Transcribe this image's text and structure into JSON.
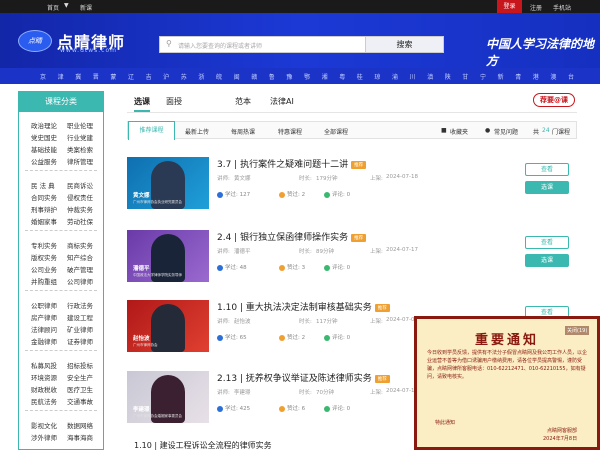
{
  "topbar": {
    "home": "首页",
    "caret": "▼",
    "news": "新课",
    "login": "登录",
    "register": "注册",
    "mobile": "手机站"
  },
  "header": {
    "logo_mark": "点睛",
    "logo_title": "点睛律师",
    "logo_url": "www.dtws.com",
    "search_placeholder": "请输入您要查询的课程或者讲师",
    "search_button": "搜索",
    "slogan": "中国人学习法律的地方"
  },
  "cities": [
    "京",
    "津",
    "冀",
    "晋",
    "蒙",
    "辽",
    "吉",
    "沪",
    "苏",
    "浙",
    "皖",
    "闽",
    "赣",
    "鲁",
    "豫",
    "鄂",
    "湘",
    "粤",
    "桂",
    "琼",
    "渝",
    "川",
    "滇",
    "陕",
    "甘",
    "宁",
    "新",
    "青",
    "港",
    "澳",
    "台"
  ],
  "sidebar": {
    "heading": "课程分类",
    "groups": [
      [
        "政治理论",
        "职业伦理",
        "党史国史",
        "行业党建",
        "基础技能",
        "类案检索",
        "公益服务",
        "律所管理"
      ],
      [
        "民 法 典",
        "民商诉讼",
        "合同实务",
        "侵权责任",
        "刑事辩护",
        "仲裁实务",
        "婚姻家事",
        "劳动社保"
      ],
      [
        "专利实务",
        "商标实务",
        "版权实务",
        "知产综合",
        "公司业务",
        "破产管理",
        "并购重组",
        "公司律师"
      ],
      [
        "公职律师",
        "行政法务",
        "房产律师",
        "建设工程",
        "法律顾问",
        "矿业律师",
        "金融律师",
        "证券律师"
      ],
      [
        "私募风投",
        "招标投标",
        "环境资源",
        "安全生产",
        "财政税收",
        "医疗卫生",
        "民航法务",
        "交通事故"
      ],
      [
        "影视文化",
        "数据网络",
        "涉外律师",
        "海事海商"
      ]
    ]
  },
  "tabs": [
    "选课",
    "面授",
    "范本",
    "法律AI"
  ],
  "badge": "荐要@课",
  "filter": {
    "items": [
      "推荐课程",
      "最新上传",
      "每周热课",
      "特惠课程",
      "全部课程"
    ],
    "fav": "收藏夹",
    "faq": "常见问题",
    "count_prefix": "共",
    "count": "24",
    "count_suffix": "门课程"
  },
  "courses": [
    {
      "title": "3.7 | 执行案件之疑难问题十二讲",
      "tag": "推荐",
      "teacher_label": "讲师:",
      "teacher": "黄文娜",
      "duration_label": "时长:",
      "duration": "179分钟",
      "date_label": "上架:",
      "date": "2024-07-18",
      "study": "127",
      "like": "2",
      "comment": "0",
      "study_label": "学过:",
      "like_label": "赞过:",
      "comment_label": "评论:",
      "thumb_name": "黄文娜",
      "thumb_sub": "广州市律师协会执业研究委员会",
      "view_btn": "查看",
      "select_btn": "选课"
    },
    {
      "title": "2.4 | 银行独立保函律师操作实务",
      "tag": "推荐",
      "teacher_label": "讲师:",
      "teacher": "潘德平",
      "duration_label": "时长:",
      "duration": "89分钟",
      "date_label": "上架:",
      "date": "2024-07-17",
      "study": "48",
      "like": "3",
      "comment": "0",
      "study_label": "学过:",
      "like_label": "赞过:",
      "comment_label": "评论:",
      "thumb_name": "潘德平",
      "thumb_sub": "中国政法大学律师学院实务导师",
      "view_btn": "查看",
      "select_btn": "选课"
    },
    {
      "title": "1.10 | 重大执法决定法制审核基础实务",
      "tag": "推荐",
      "teacher_label": "讲师:",
      "teacher": "赵怡波",
      "duration_label": "时长:",
      "duration": "117分钟",
      "date_label": "上架:",
      "date": "2024-07-06",
      "study": "65",
      "like": "2",
      "comment": "0",
      "study_label": "学过:",
      "like_label": "赞过:",
      "comment_label": "评论:",
      "thumb_name": "赵怡波",
      "thumb_sub": "广州市律师协会",
      "view_btn": "查看",
      "select_btn": "选课"
    },
    {
      "title": "2.13 | 抚养权争议举证及陈述律师实务",
      "tag": "推荐",
      "teacher_label": "讲师:",
      "teacher": "李建璟",
      "duration_label": "时长:",
      "duration": "70分钟",
      "date_label": "上架:",
      "date": "2024-07-13",
      "study": "425",
      "like": "6",
      "comment": "0",
      "study_label": "学过:",
      "like_label": "赞过:",
      "comment_label": "评论:",
      "thumb_name": "李建璟",
      "thumb_sub": "广州市律师协会婚姻家事委员会",
      "view_btn": "查看",
      "select_btn": "选课"
    }
  ],
  "partial_title": "1.10 | 建设工程诉讼全流程的律师实务",
  "notice": {
    "title": "重要通知",
    "close": "关闭(19)",
    "body": "今日收到学员反馈，提供有不法分子假冒点睛网及我公司工作人员，以企业运营不善等为借口诱骗用户缴纳费用，请各位学员提高警惕，谨防受骗，点睛网律所客服电话：010-62212471、010-62210155，如有疑问，请致电核实。",
    "sign": "特此通知",
    "org": "点睛网客服部",
    "date": "2024年7月8日"
  },
  "colors": {
    "teal": "#3bb8b0",
    "header_blue": "#1c39d6",
    "red": "#c8161d",
    "tag": "#f0a030"
  }
}
